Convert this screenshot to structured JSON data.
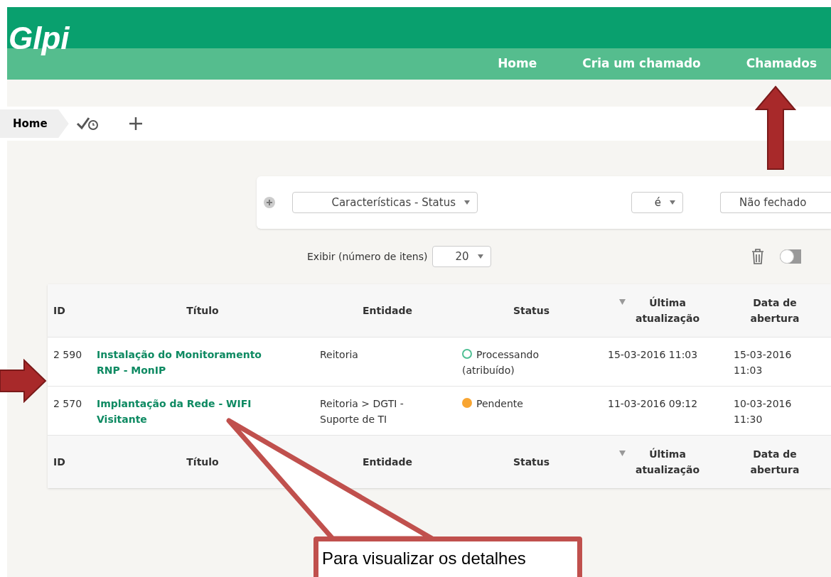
{
  "header": {
    "logo": "Glpi",
    "nav": [
      {
        "label": "Home"
      },
      {
        "label": "Cria um chamado"
      },
      {
        "label": "Chamados"
      }
    ]
  },
  "breadcrumb": {
    "items": [
      {
        "label": "Home"
      }
    ]
  },
  "filter": {
    "field": "Características - Status",
    "operator": "é",
    "value": "Não fechado"
  },
  "display": {
    "label": "Exibir (número de itens)",
    "value": "20",
    "toggle_on": false
  },
  "table": {
    "columns": [
      {
        "label": "ID",
        "sorted": false
      },
      {
        "label": "Título",
        "sorted": false
      },
      {
        "label": "Entidade",
        "sorted": false
      },
      {
        "label": "Status",
        "sorted": false
      },
      {
        "label": "Última atualização",
        "sorted": true
      },
      {
        "label": "Data de abertura",
        "sorted": false
      }
    ],
    "footer_columns": [
      {
        "label": "ID",
        "sorted": false
      },
      {
        "label": "Título",
        "sorted": false
      },
      {
        "label": "Entidade",
        "sorted": false
      },
      {
        "label": "Status",
        "sorted": false
      },
      {
        "label": "Última atualização",
        "sorted": true
      },
      {
        "label": "Data de abertura",
        "sorted": false
      }
    ],
    "rows": [
      {
        "id": "2 590",
        "title": "Instalação do Monitoramento RNP - MonIP",
        "entity": "Reitoria",
        "status": "Processando (atribuído)",
        "hollow_dot": true,
        "color": "#4fbf94",
        "updated": "15-03-2016 11:03",
        "opened": "15-03-2016 11:03"
      },
      {
        "id": "2 570",
        "title": "Implantação da Rede - WIFI Visitante",
        "entity": "Reitoria > DGTI - Suporte de TI",
        "status": "Pendente",
        "hollow_dot": false,
        "color": "#f8a532",
        "updated": "11-03-2016 09:12",
        "opened": "10-03-2016 11:30"
      }
    ]
  },
  "callout": {
    "text": "Para visualizar os detalhes"
  }
}
